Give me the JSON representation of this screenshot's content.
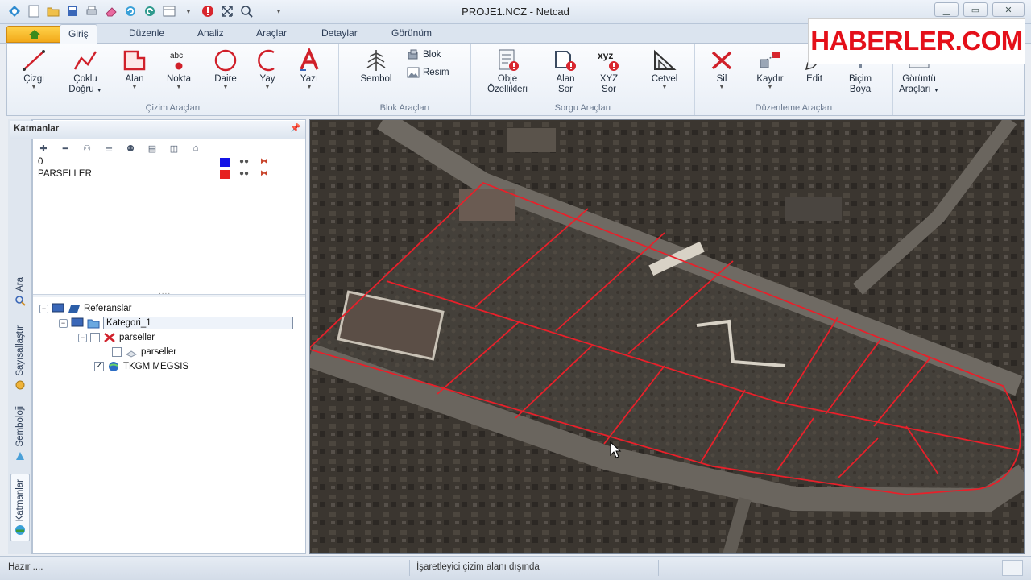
{
  "window": {
    "title": "PROJE1.NCZ - Netcad"
  },
  "ribbon_tabs": [
    "Giriş",
    "Düzenle",
    "Analiz",
    "Araçlar",
    "Detaylar",
    "Görünüm"
  ],
  "ribbon": {
    "cizim": {
      "label": "Çizim Araçları",
      "cizgi": "Çizgi",
      "coklu_line1": "Çoklu",
      "coklu_line2": "Doğru",
      "alan": "Alan",
      "nokta_icon_text": "abc",
      "nokta": "Nokta",
      "daire": "Daire",
      "yay": "Yay",
      "yazi": "Yazı"
    },
    "blok": {
      "label": "Blok Araçları",
      "sembol": "Sembol",
      "blok": "Blok",
      "resim": "Resim"
    },
    "sorgu": {
      "label": "Sorgu Araçları",
      "obje_line1": "Obje",
      "obje_line2": "Özellikleri",
      "alan_line1": "Alan",
      "alan_line2": "Sor",
      "xyz_icon_text": "xyz",
      "xyz_line1": "XYZ",
      "xyz_line2": "Sor",
      "cetvel": "Cetvel"
    },
    "duzenleme": {
      "label": "Düzenleme Araçları",
      "sil": "Sil",
      "kaydir": "Kaydır",
      "edit": "Edit",
      "bicim_line1": "Biçim",
      "bicim_line2": "Boya"
    },
    "goruntu": {
      "line1": "Görüntü",
      "line2": "Araçları"
    }
  },
  "watermark": {
    "text": "HABERLER.COM"
  },
  "side_tabs": [
    "Ara",
    "Sayısallaştır",
    "Semboloji",
    "Katmanlar"
  ],
  "layers_panel": {
    "title": "Katmanlar",
    "layers": [
      {
        "name": "0",
        "color": "#1414e6"
      },
      {
        "name": "PARSELLER",
        "color": "#e62020"
      }
    ]
  },
  "tree": {
    "referanslar": "Referanslar",
    "kategori": "Kategori_1",
    "parseller_group": "parseller",
    "parseller_item": "parseller",
    "tkgm": "TKGM MEGSIS"
  },
  "status": {
    "left": "Hazır ....",
    "mid": "İşaretleyici çizim alanı dışında"
  },
  "colors": {
    "parcel_line": "#e8202a",
    "accent": "#2b5ea8"
  }
}
